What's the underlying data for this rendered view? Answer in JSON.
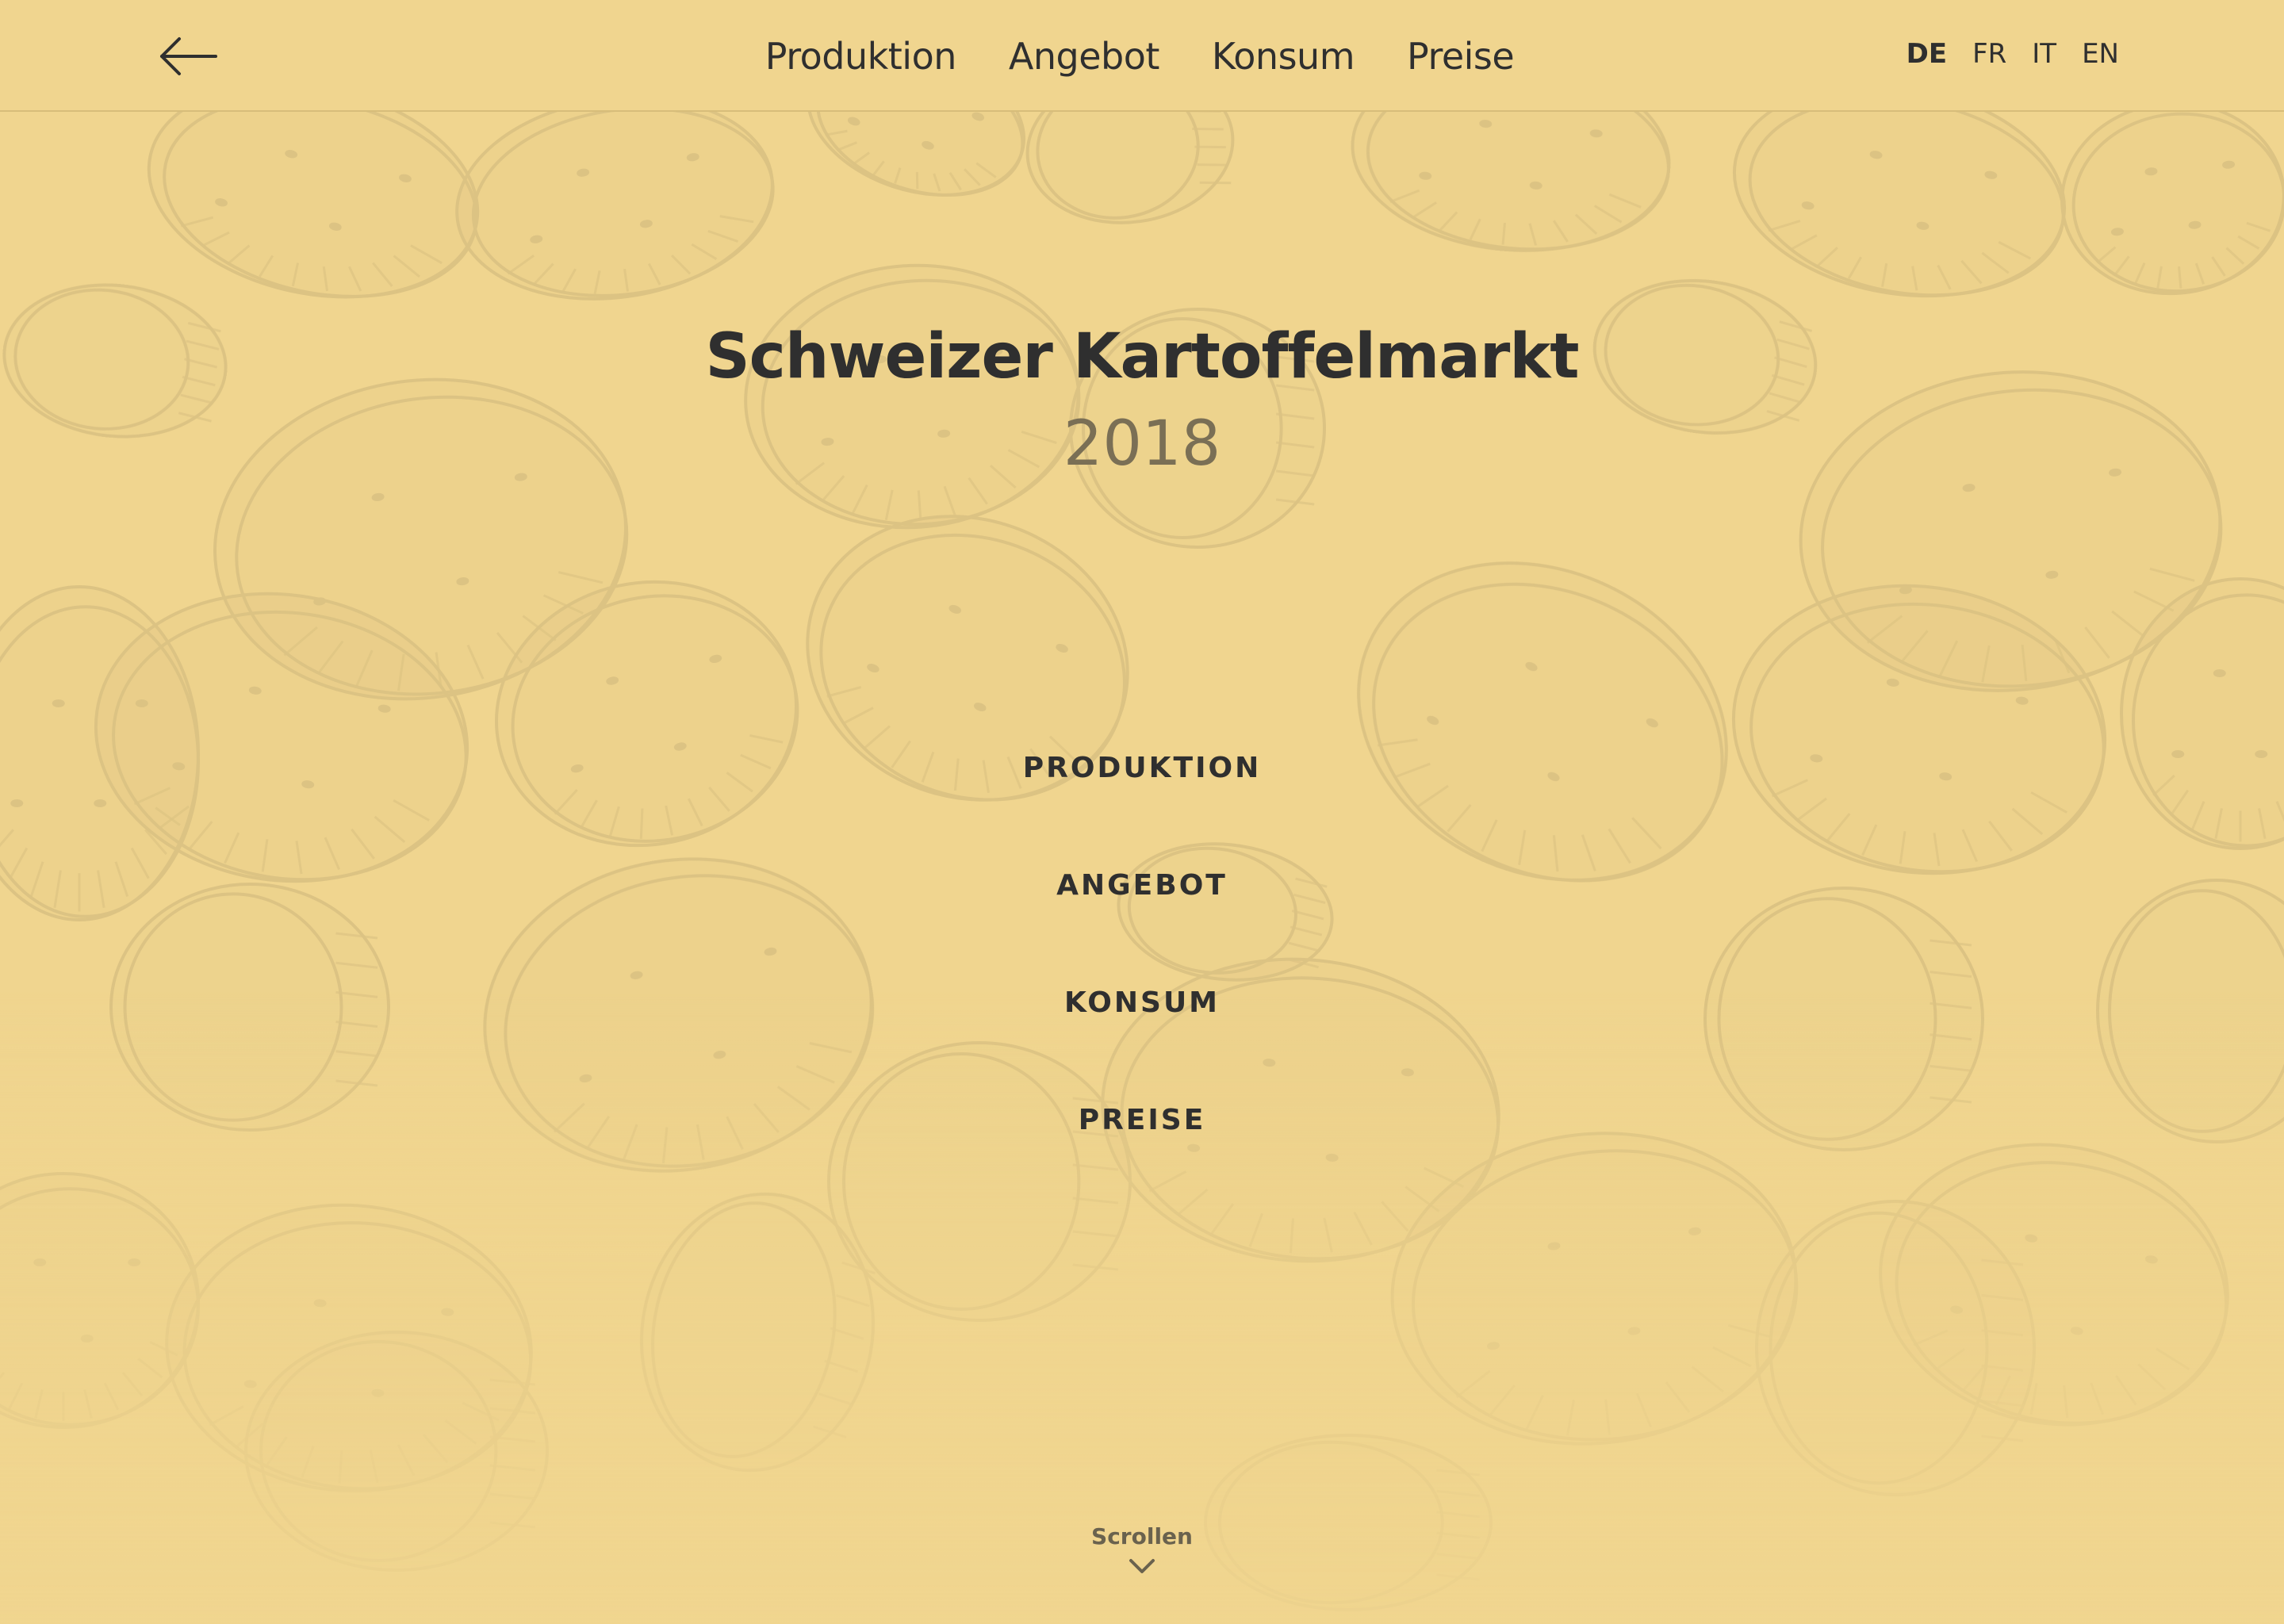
{
  "header": {
    "back_label": "back",
    "nav": [
      {
        "label": "Produktion"
      },
      {
        "label": "Angebot"
      },
      {
        "label": "Konsum"
      },
      {
        "label": "Preise"
      }
    ],
    "languages": [
      {
        "code": "DE",
        "active": true
      },
      {
        "code": "FR",
        "active": false
      },
      {
        "code": "IT",
        "active": false
      },
      {
        "code": "EN",
        "active": false
      }
    ]
  },
  "hero": {
    "title": "Schweizer Kartoffelmarkt",
    "year": "2018"
  },
  "sections": [
    {
      "label": "PRODUKTION"
    },
    {
      "label": "ANGEBOT"
    },
    {
      "label": "KONSUM"
    },
    {
      "label": "PREISE"
    }
  ],
  "scroll": {
    "label": "Scrollen",
    "icon": "chevron-down-icon"
  },
  "colors": {
    "background": "#f0d58f",
    "pattern": "#d8bf80",
    "text": "#2f2f2f",
    "year": "#7a6f55"
  },
  "background_pattern": "potato-illustration"
}
